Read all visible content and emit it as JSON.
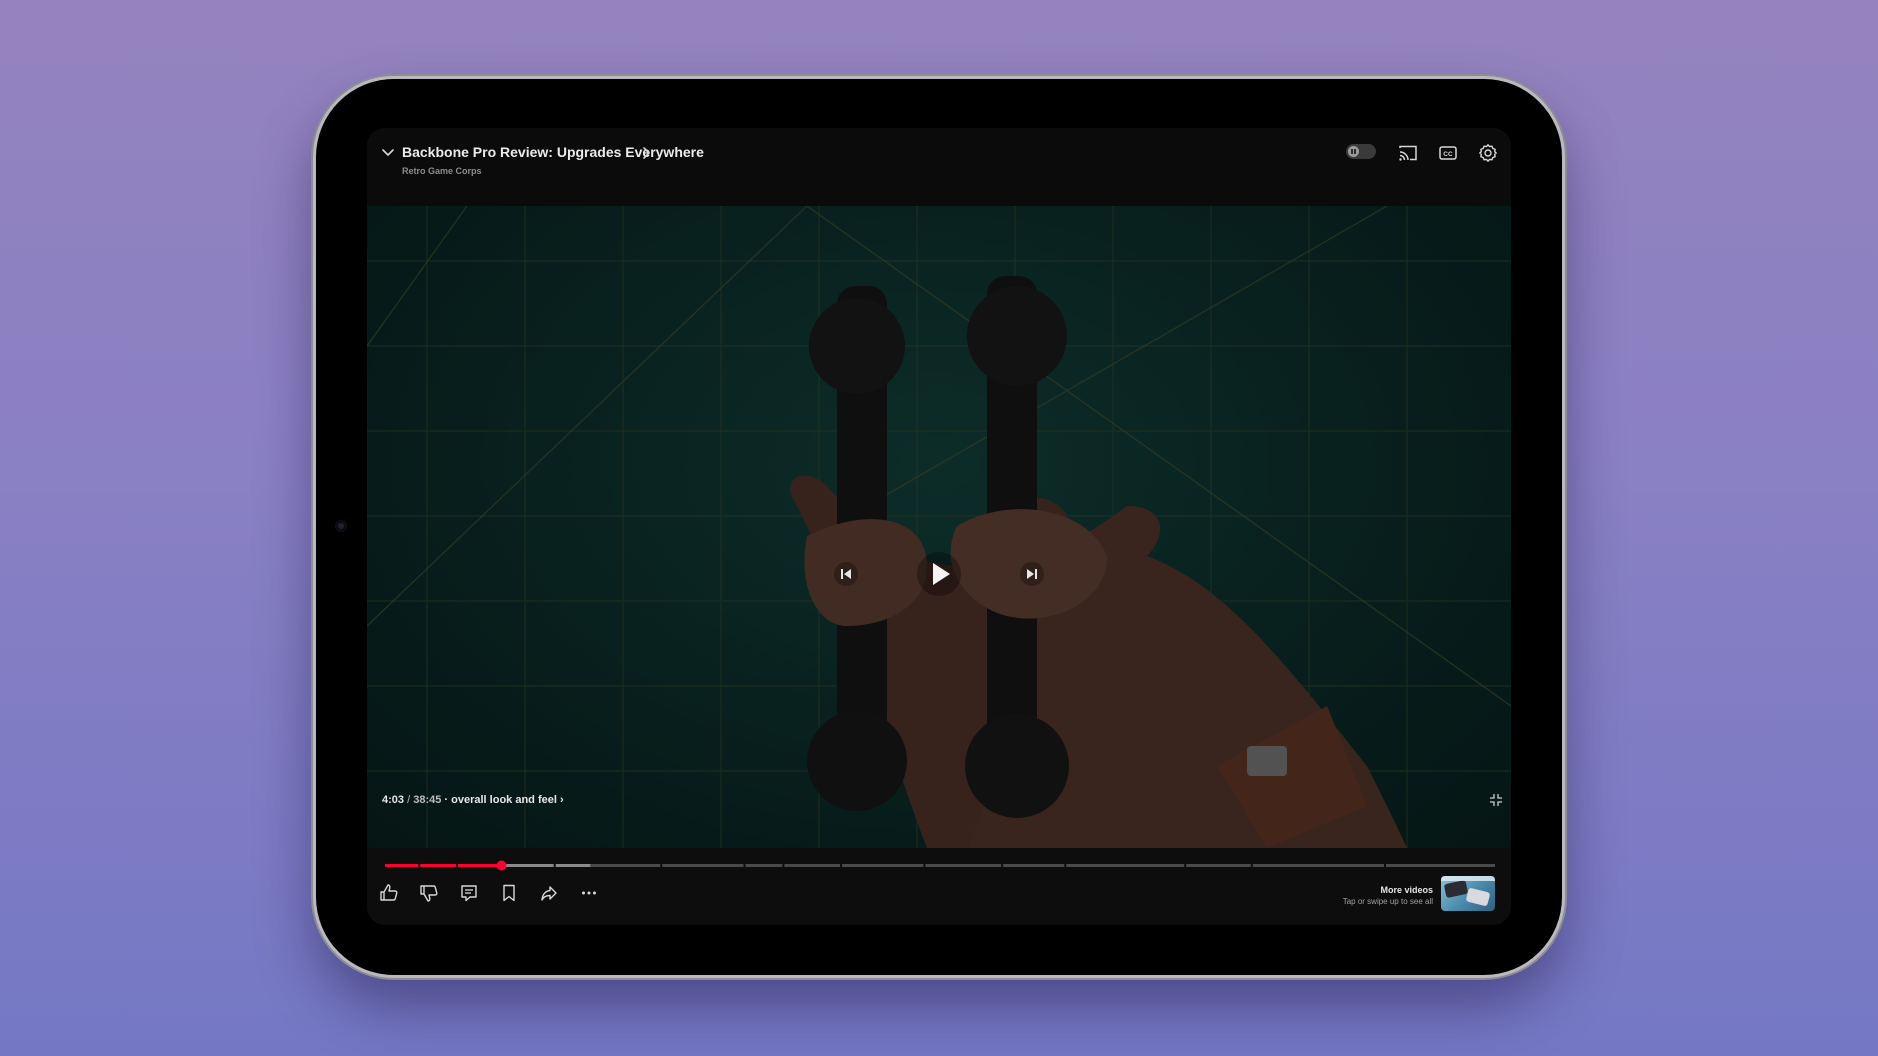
{
  "video": {
    "title": "Backbone Pro Review: Upgrades Everywhere",
    "channel": "Retro Game Corps",
    "current_time": "4:03",
    "separator": "/",
    "duration": "38:45",
    "chapter": "· overall look and feel",
    "progress_fraction": 0.105,
    "buffered_fraction": 0.185
  },
  "topbar": {
    "icons": [
      "chevron-down-icon",
      "autoplay-toggle",
      "cast-icon",
      "captions-icon",
      "settings-icon"
    ],
    "autoplay_on": false
  },
  "player_controls": {
    "icons": [
      "previous-icon",
      "play-icon",
      "next-icon",
      "fullscreen-exit-icon"
    ]
  },
  "actions": {
    "icons": [
      "like-icon",
      "dislike-icon",
      "comments-icon",
      "save-icon",
      "share-icon",
      "more-icon"
    ]
  },
  "more_videos": {
    "title": "More videos",
    "subtitle": "Tap or swipe up to see all"
  },
  "colors": {
    "accent": "#ff0033",
    "text": "#ececec",
    "muted": "#8d8d8d",
    "background": "#0d0d0d"
  }
}
